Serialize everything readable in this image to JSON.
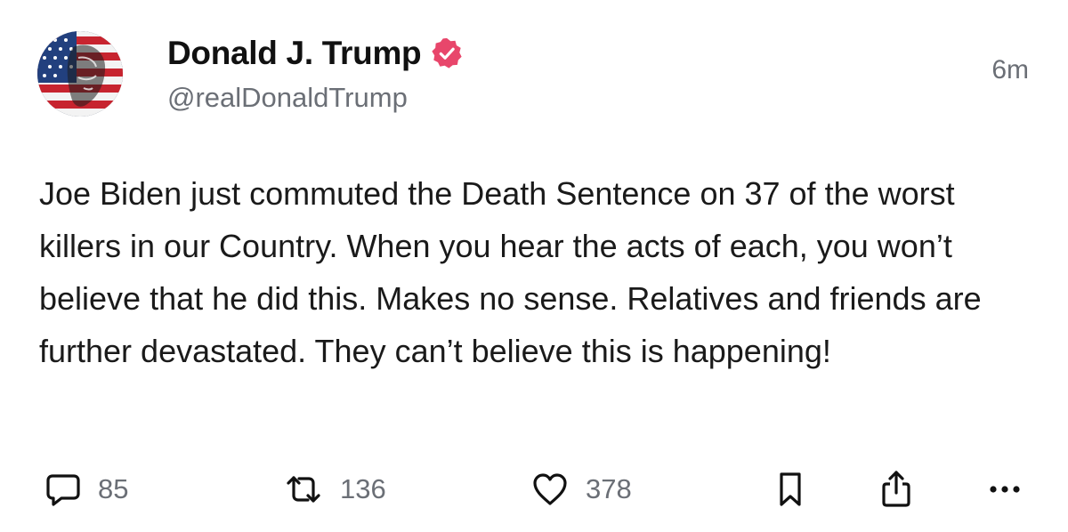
{
  "post": {
    "display_name": "Donald J. Trump",
    "handle": "@realDonaldTrump",
    "timestamp": "6m",
    "verified": true,
    "verified_color": "#e8466b",
    "text": "Joe Biden just commuted the Death Sentence on 37 of the worst killers in our Country. When you hear the acts of each, you won’t believe that he did this. Makes no sense. Relatives and friends are further devastated. They can’t believe this is happening!"
  },
  "actions": {
    "replies": {
      "icon": "comment-icon",
      "count": "85"
    },
    "reposts": {
      "icon": "repost-icon",
      "count": "136"
    },
    "likes": {
      "icon": "heart-icon",
      "count": "378"
    },
    "bookmark": {
      "icon": "bookmark-icon"
    },
    "share": {
      "icon": "share-icon"
    },
    "more": {
      "icon": "more-icon"
    }
  },
  "colors": {
    "text": "#111111",
    "muted": "#6b6f76",
    "background": "#ffffff"
  }
}
